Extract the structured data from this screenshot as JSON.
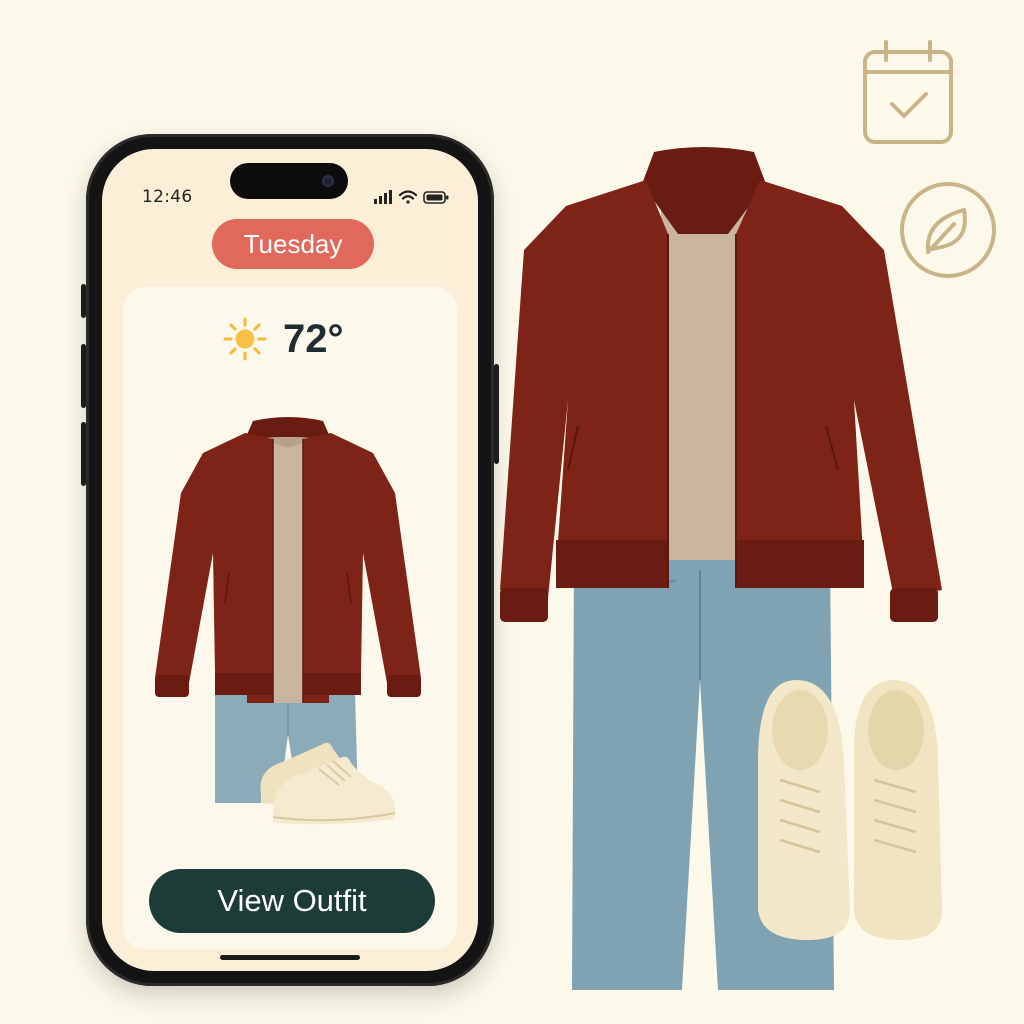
{
  "status_bar": {
    "time": "12:46"
  },
  "day_pill": {
    "label": "Tuesday"
  },
  "weather": {
    "icon": "sun-icon",
    "temperature": "72°"
  },
  "outfit": {
    "items": [
      "jacket",
      "t-shirt",
      "jeans",
      "sneakers"
    ]
  },
  "view_outfit_button": {
    "label": "View Outfit"
  },
  "side_icons": [
    "calendar-check-icon",
    "leaf-icon"
  ],
  "colors": {
    "background": "#fdf9ea",
    "day_pill": "#e0695c",
    "button": "#1d3c37",
    "jacket": "#7e2317",
    "t_shirt": "#c9b49f",
    "jeans": "#7fa3b3",
    "sneakers": "#f2e8c9",
    "icon_outline": "#c9b48a"
  }
}
